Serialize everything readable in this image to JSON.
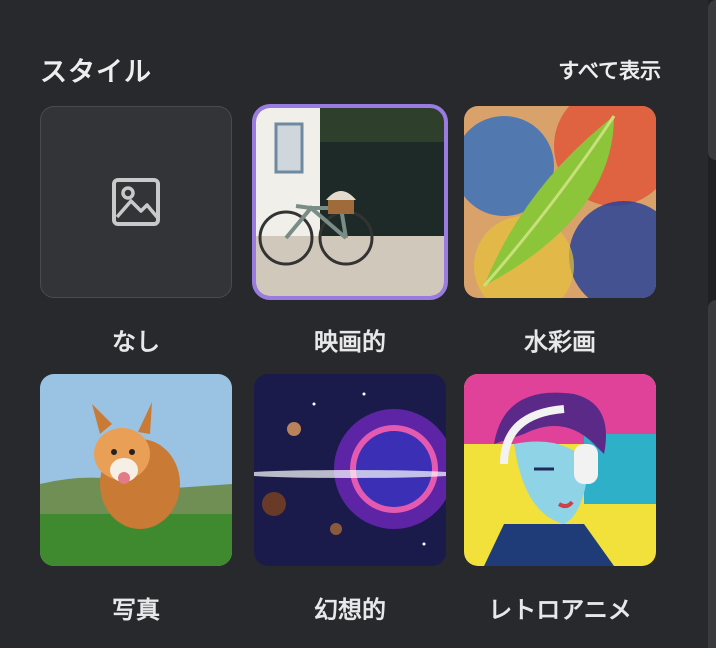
{
  "header": {
    "title": "スタイル",
    "show_all_label": "すべて表示"
  },
  "styles": [
    {
      "label": "なし",
      "icon": "image-placeholder-icon",
      "selected": false
    },
    {
      "label": "映画的",
      "selected": true
    },
    {
      "label": "水彩画",
      "selected": false
    },
    {
      "label": "写真",
      "selected": false
    },
    {
      "label": "幻想的",
      "selected": false
    },
    {
      "label": "レトロアニメ",
      "selected": false
    }
  ],
  "colors": {
    "background": "#28292c",
    "selected_outline": "#9a7ce0"
  }
}
